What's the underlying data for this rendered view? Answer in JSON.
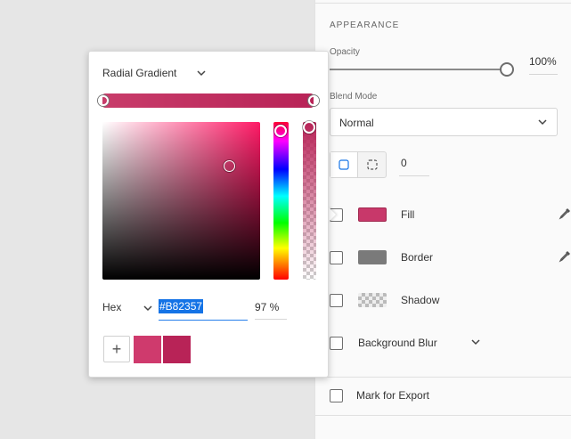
{
  "appearance": {
    "section_title": "APPEARANCE",
    "opacity_label": "Opacity",
    "opacity_value": "100%",
    "opacity_level": 1.0,
    "blend_label": "Blend Mode",
    "blend_value": "Normal",
    "corner_radius_value": "0",
    "rows": [
      {
        "label": "Fill",
        "color": "#c8386a",
        "checked": true
      },
      {
        "label": "Border",
        "color": "#7a7a7a",
        "checked": false
      },
      {
        "label": "Shadow",
        "checked": false
      },
      {
        "label": "Background Blur",
        "checked": false
      }
    ],
    "export_label": "Mark for Export"
  },
  "picker": {
    "gradient_type": "Radial Gradient",
    "gradient_colors": [
      "#c83c6a",
      "#b82357"
    ],
    "hue_color": "#ff1a66",
    "format_label": "Hex",
    "hex_value": "#B82357",
    "alpha_value": "97 %",
    "saved_swatches": [
      "#cf3a6d",
      "#b82357"
    ]
  }
}
